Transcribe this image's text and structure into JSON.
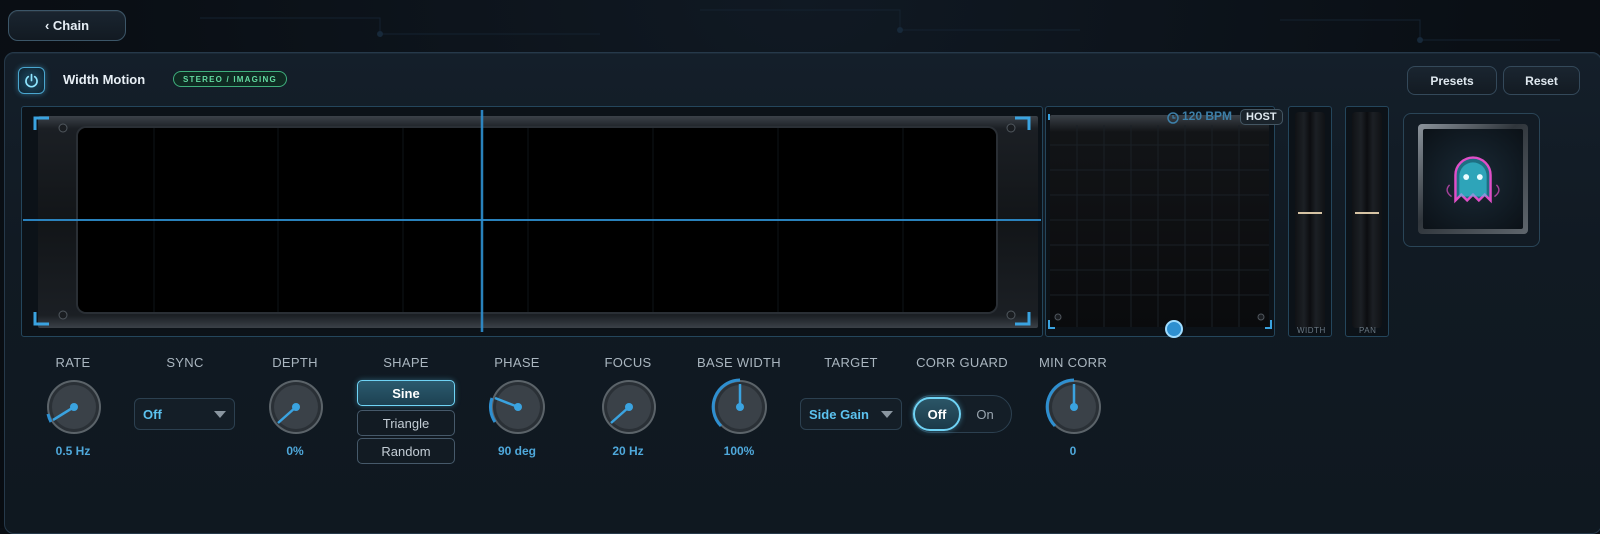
{
  "nav": {
    "back_label": "‹ Chain"
  },
  "header": {
    "title": "Width Motion",
    "badge": "STEREO / IMAGING",
    "presets_label": "Presets",
    "reset_label": "Reset"
  },
  "display": {
    "bpm": "120 BPM",
    "host": "HOST",
    "width_label": "WIDTH",
    "pan_label": "PAN",
    "width_level": 0.5,
    "pan_level": 0.5
  },
  "controls": {
    "rate": {
      "label": "RATE",
      "value": "0.5 Hz"
    },
    "sync": {
      "label": "SYNC",
      "value": "Off"
    },
    "depth": {
      "label": "DEPTH",
      "value": "0%"
    },
    "shape": {
      "label": "SHAPE",
      "options": [
        "Sine",
        "Triangle",
        "Random"
      ],
      "selected": "Sine"
    },
    "phase": {
      "label": "PHASE",
      "value": "90 deg"
    },
    "focus": {
      "label": "FOCUS",
      "value": "20 Hz"
    },
    "base_width": {
      "label": "BASE WIDTH",
      "value": "100%"
    },
    "target": {
      "label": "TARGET",
      "value": "Side Gain"
    },
    "corr_guard": {
      "label": "CORR GUARD",
      "off_label": "Off",
      "on_label": "On",
      "state": "Off"
    },
    "min_corr": {
      "label": "MIN CORR",
      "value": "0"
    }
  },
  "colors": {
    "accent": "#4fa8db",
    "accent_bright": "#6fd3f5",
    "badge_green": "#63d9a0",
    "trace": "#2e8fd0"
  }
}
